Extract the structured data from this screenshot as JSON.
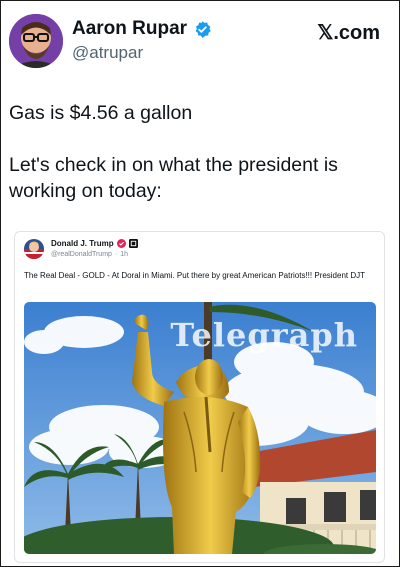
{
  "author": {
    "display_name": "Aaron Rupar",
    "handle": "@atrupar",
    "verified_icon": "verified-badge-icon"
  },
  "brand": {
    "label": "𝕏.com"
  },
  "tweet": {
    "paragraphs": [
      "Gas is $4.56 a gallon",
      "Let's check in on what the president is working on today:"
    ]
  },
  "quoted_post": {
    "display_name": "Donald J. Trump",
    "handle": "@realDonaldTrump",
    "separator": "·",
    "age": "1h",
    "text": "The Real Deal - GOLD - At Doral in Miami. Put there by great American Patriots!!! President DJT",
    "media": {
      "watermark": "Telegraph"
    }
  },
  "colors": {
    "verified_blue": "#1d9bf0",
    "text_primary": "#0f1419",
    "text_secondary": "#536471"
  }
}
